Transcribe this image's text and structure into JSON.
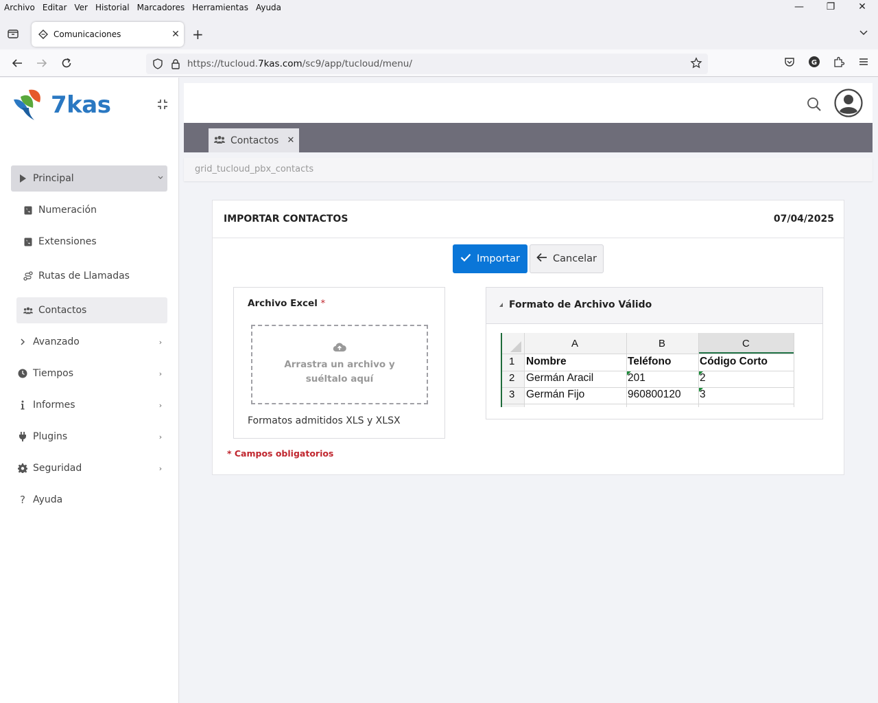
{
  "browser": {
    "menu": [
      "Archivo",
      "Editar",
      "Ver",
      "Historial",
      "Marcadores",
      "Herramientas",
      "Ayuda"
    ],
    "tab_title": "Comunicaciones",
    "url_prefix": "https://tucloud.",
    "url_domain": "7kas.com",
    "url_path": "/sc9/app/tucloud/menu/"
  },
  "sidebar": {
    "logo_text": "7kas",
    "items": [
      {
        "label": "Principal",
        "icon": "play-icon"
      },
      {
        "label": "Numeración",
        "icon": "phone-book-icon"
      },
      {
        "label": "Extensiones",
        "icon": "phone-book-icon"
      },
      {
        "label": "Rutas de Llamadas",
        "icon": "route-icon"
      },
      {
        "label": "Contactos",
        "icon": "users-icon"
      },
      {
        "label": "Avanzado",
        "icon": "chevron-right-icon"
      },
      {
        "label": "Tiempos",
        "icon": "clock-icon"
      },
      {
        "label": "Informes",
        "icon": "info-icon"
      },
      {
        "label": "Plugins",
        "icon": "plug-icon"
      },
      {
        "label": "Seguridad",
        "icon": "gear-icon"
      },
      {
        "label": "Ayuda",
        "icon": "question-icon"
      }
    ]
  },
  "app": {
    "open_tab": "Contactos",
    "breadcrumb": "grid_tucloud_pbx_contacts"
  },
  "form": {
    "title": "IMPORTAR CONTACTOS",
    "date": "07/04/2025",
    "import_label": "Importar",
    "cancel_label": "Cancelar",
    "file_label": "Archivo Excel",
    "required_mark": "*",
    "dropzone_text": "Arrastra un archivo y suéltalo aquí",
    "formats_text": "Formatos admitidos XLS y XLSX",
    "required_note": "* Campos obligatorios",
    "format_title": "Formato de Archivo Válido"
  },
  "sheet": {
    "columns": [
      "A",
      "B",
      "C"
    ],
    "row_numbers": [
      "1",
      "2",
      "3"
    ],
    "rows": [
      [
        "Nombre",
        "Teléfono",
        "Código Corto"
      ],
      [
        "Germán Aracil",
        "201",
        "2"
      ],
      [
        "Germán Fijo",
        "960800120",
        "3"
      ]
    ]
  },
  "colors": {
    "primary": "#0a76d8",
    "required": "#c0262e",
    "tabstrip": "#6e6d79",
    "logo_blue": "#2a78c2"
  }
}
